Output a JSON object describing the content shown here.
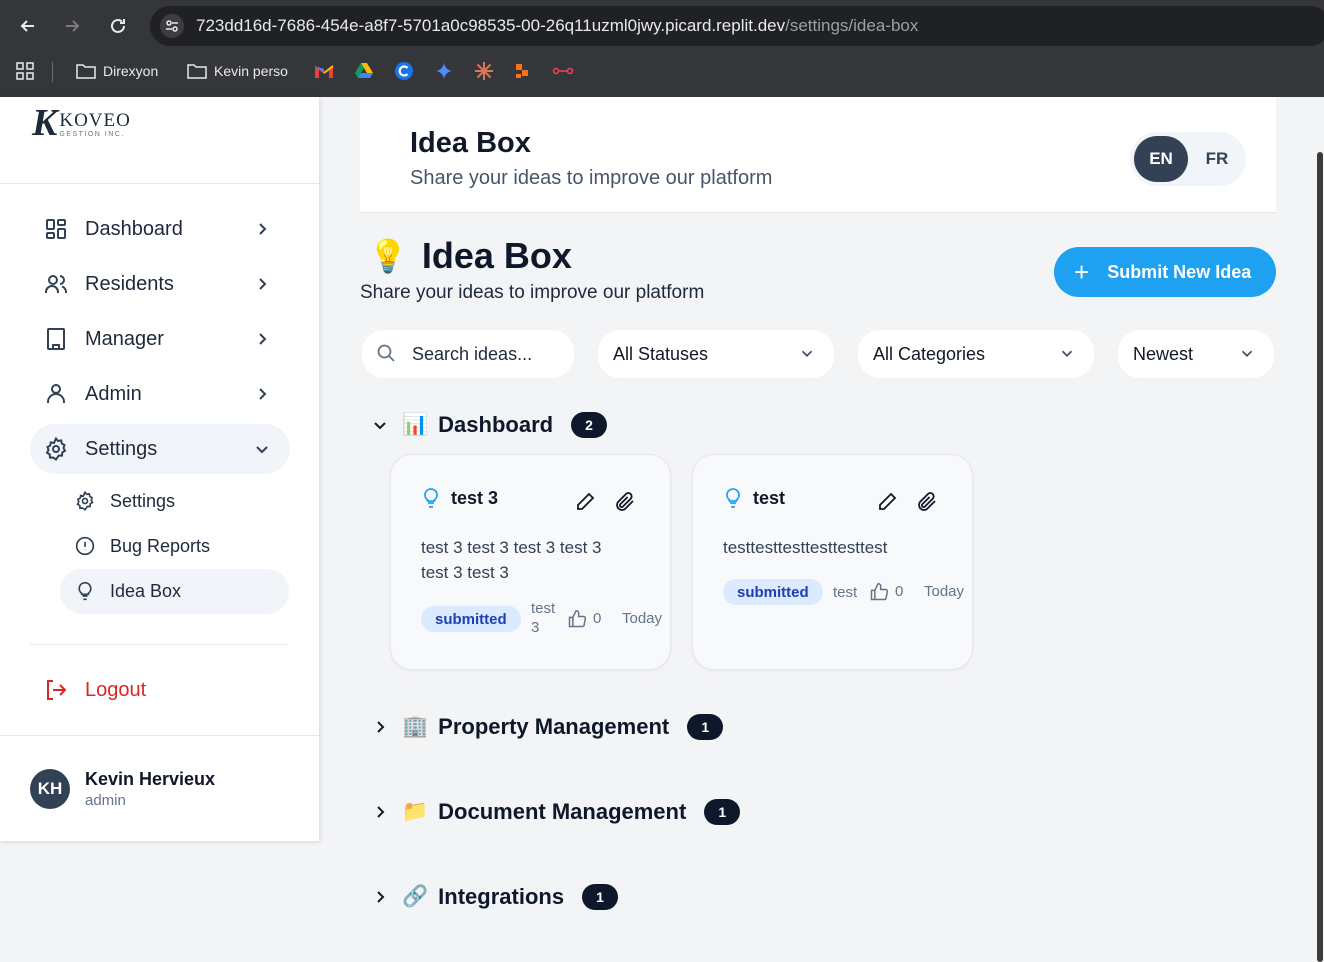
{
  "browser": {
    "url_main": "723dd16d-7686-454e-a8f7-5701a0c98535-00-26q11uzml0jwy.picard.replit.dev",
    "url_path": "/settings/idea-box",
    "bookmarks": [
      {
        "label": "Direxyon",
        "icon": "folder-icon"
      },
      {
        "label": "Kevin perso",
        "icon": "folder-icon"
      }
    ]
  },
  "brand": {
    "logo_letter": "K",
    "logo_name": "KOVEO",
    "logo_sub": "GESTION INC."
  },
  "sidebar": {
    "items": [
      {
        "label": "Dashboard",
        "icon": "dashboard-icon"
      },
      {
        "label": "Residents",
        "icon": "users-icon"
      },
      {
        "label": "Manager",
        "icon": "building-icon"
      },
      {
        "label": "Admin",
        "icon": "user-icon"
      },
      {
        "label": "Settings",
        "icon": "gear-icon"
      }
    ],
    "sub_items": [
      {
        "label": "Settings",
        "icon": "gear-icon"
      },
      {
        "label": "Bug Reports",
        "icon": "alert-circle-icon"
      },
      {
        "label": "Idea Box",
        "icon": "lightbulb-icon"
      }
    ],
    "logout": "Logout",
    "user": {
      "initials": "KH",
      "name": "Kevin Hervieux",
      "role": "admin"
    }
  },
  "header": {
    "title": "Idea Box",
    "subtitle": "Share your ideas to improve our platform",
    "lang_en": "EN",
    "lang_fr": "FR"
  },
  "main": {
    "emoji": "💡",
    "title": "Idea Box",
    "subtitle": "Share your ideas to improve our platform",
    "submit_label": "Submit New Idea",
    "search_placeholder": "Search ideas...",
    "status_filter": "All Statuses",
    "category_filter": "All Categories",
    "sort": "Newest"
  },
  "categories": [
    {
      "emoji": "📊",
      "title": "Dashboard",
      "count": "2",
      "expanded": true
    },
    {
      "emoji": "🏢",
      "title": "Property Management",
      "count": "1",
      "expanded": false
    },
    {
      "emoji": "📁",
      "title": "Document Management",
      "count": "1",
      "expanded": false
    },
    {
      "emoji": "🔗",
      "title": "Integrations",
      "count": "1",
      "expanded": false
    }
  ],
  "ideas": [
    {
      "title": "test 3",
      "description_line1": "test 3 test 3 test 3 test 3",
      "description_line2": "test 3 test 3",
      "status": "submitted",
      "category_line1": "test",
      "category_line2": "3",
      "votes": "0",
      "date": "Today"
    },
    {
      "title": "test",
      "description_line1": "testtesttesttesttesttest",
      "status": "submitted",
      "category": "test",
      "votes": "0",
      "date": "Today"
    }
  ],
  "colors": {
    "accent": "#1ea1f1",
    "sidebar_active": "#f1f5f9",
    "logout": "#dc2626",
    "badge_bg": "#dbeafe",
    "badge_text": "#1e40af"
  }
}
